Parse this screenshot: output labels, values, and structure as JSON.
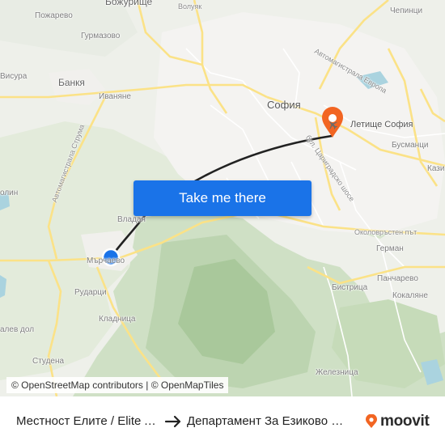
{
  "map": {
    "labels": {
      "pozharevo": "Пожарево",
      "bozhurishte": "Божурище",
      "volyak": "Волуяк",
      "chepintsi": "Чепинци",
      "gurmazovo": "Гурмазово",
      "bankya": "Банкя",
      "visura": "Висура",
      "ivanyane": "Иваняне",
      "sofia": "София",
      "letishte": "Летище София",
      "busmantsi": "Бусманци",
      "kazi": "Кази",
      "avtomagistrala_evropa": "Автомагистрала Европа",
      "avtomagistrala_struma": "Автомагистрала Струма",
      "tsarigradsko": "бул. Цариградско шосе",
      "okolovrasten": "Околовръстен път",
      "golin": "олин",
      "vladaya": "Владая",
      "marchaevo": "Мърчаево",
      "rudartsi": "Рударци",
      "german": "Герман",
      "pancharevo": "Панчарево",
      "bistritsa": "Бистрица",
      "kokalyane": "Кокаляне",
      "kladnitsa": "Кладница",
      "palalev_dol": "алев дол",
      "studena": "Студена",
      "zheleznitsa": "Железница"
    },
    "button_label": "Take me there",
    "attribution": "© OpenStreetMap contributors | © OpenMapTiles"
  },
  "footer": {
    "from": "Местност Елите / Elite Area",
    "to": "Департамент За Езиково Обучение",
    "brand": "moovit"
  },
  "colors": {
    "button": "#1a73e8",
    "origin_marker": "#1a73e8",
    "destination_marker": "#f26522",
    "brand_orange": "#f26522",
    "route": "#222222"
  }
}
